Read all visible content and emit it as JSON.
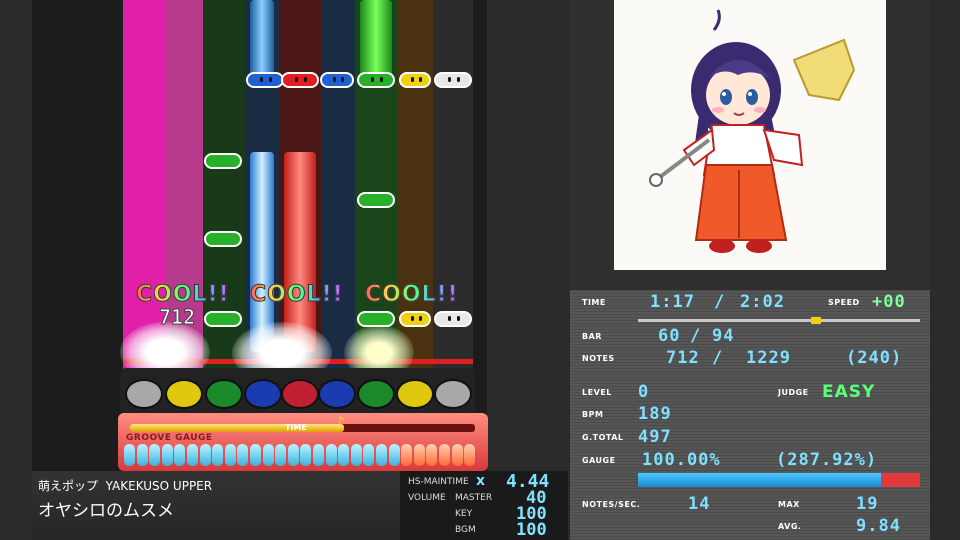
{
  "lane_colors": [
    "#5a0f3a",
    "#7a1a52",
    "#2a4a2a",
    "#1a2a48",
    "#4a1414",
    "#1a2a48",
    "#1e4a1e",
    "#5a3a0a",
    "#2a2a2a"
  ],
  "judgement": {
    "word": "COOL!!",
    "combo": "712"
  },
  "gauge": {
    "label": "GROOVE GAUGE",
    "time_label": "TIME"
  },
  "song": {
    "genre": "萌えポップ",
    "artist": "YAKEKUSO UPPER",
    "title": "オヤシロのムスメ"
  },
  "hispeed": {
    "label": "HS-MAINTIME",
    "x_mark": "x",
    "value": "4.44",
    "volume_label": "VOLUME",
    "master_label": "MASTER",
    "master_value": "40",
    "key_label": "KEY",
    "key_value": "100",
    "bgm_label": "BGM",
    "bgm_value": "100"
  },
  "stats": {
    "time_label": "TIME",
    "time_current": "1:17",
    "time_sep": "/",
    "time_total": "2:02",
    "speed_label": "SPEED",
    "speed_value": "+00",
    "time_progress": 0.63,
    "bar_label": "BAR",
    "bar_current": "60",
    "bar_sep": "/",
    "bar_total": "94",
    "notes_label": "NOTES",
    "notes_current": "712",
    "notes_sep": "/",
    "notes_total": "1229",
    "notes_extra": "(240)",
    "level_label": "LEVEL",
    "level_value": "0",
    "judge_label": "JUDGE",
    "judge_value": "EASY",
    "bpm_label": "BPM",
    "bpm_value": "189",
    "gtotal_label": "G.TOTAL",
    "gtotal_value": "497",
    "gauge_label": "GAUGE",
    "gauge_value": "100.00%",
    "gauge_extra": "(287.92%)",
    "gauge_fill": 0.86,
    "nps_label": "NOTES/SEC.",
    "nps_value": "14",
    "max_label": "MAX",
    "max_value": "19",
    "avg_label": "AVG.",
    "avg_value": "9.84"
  }
}
